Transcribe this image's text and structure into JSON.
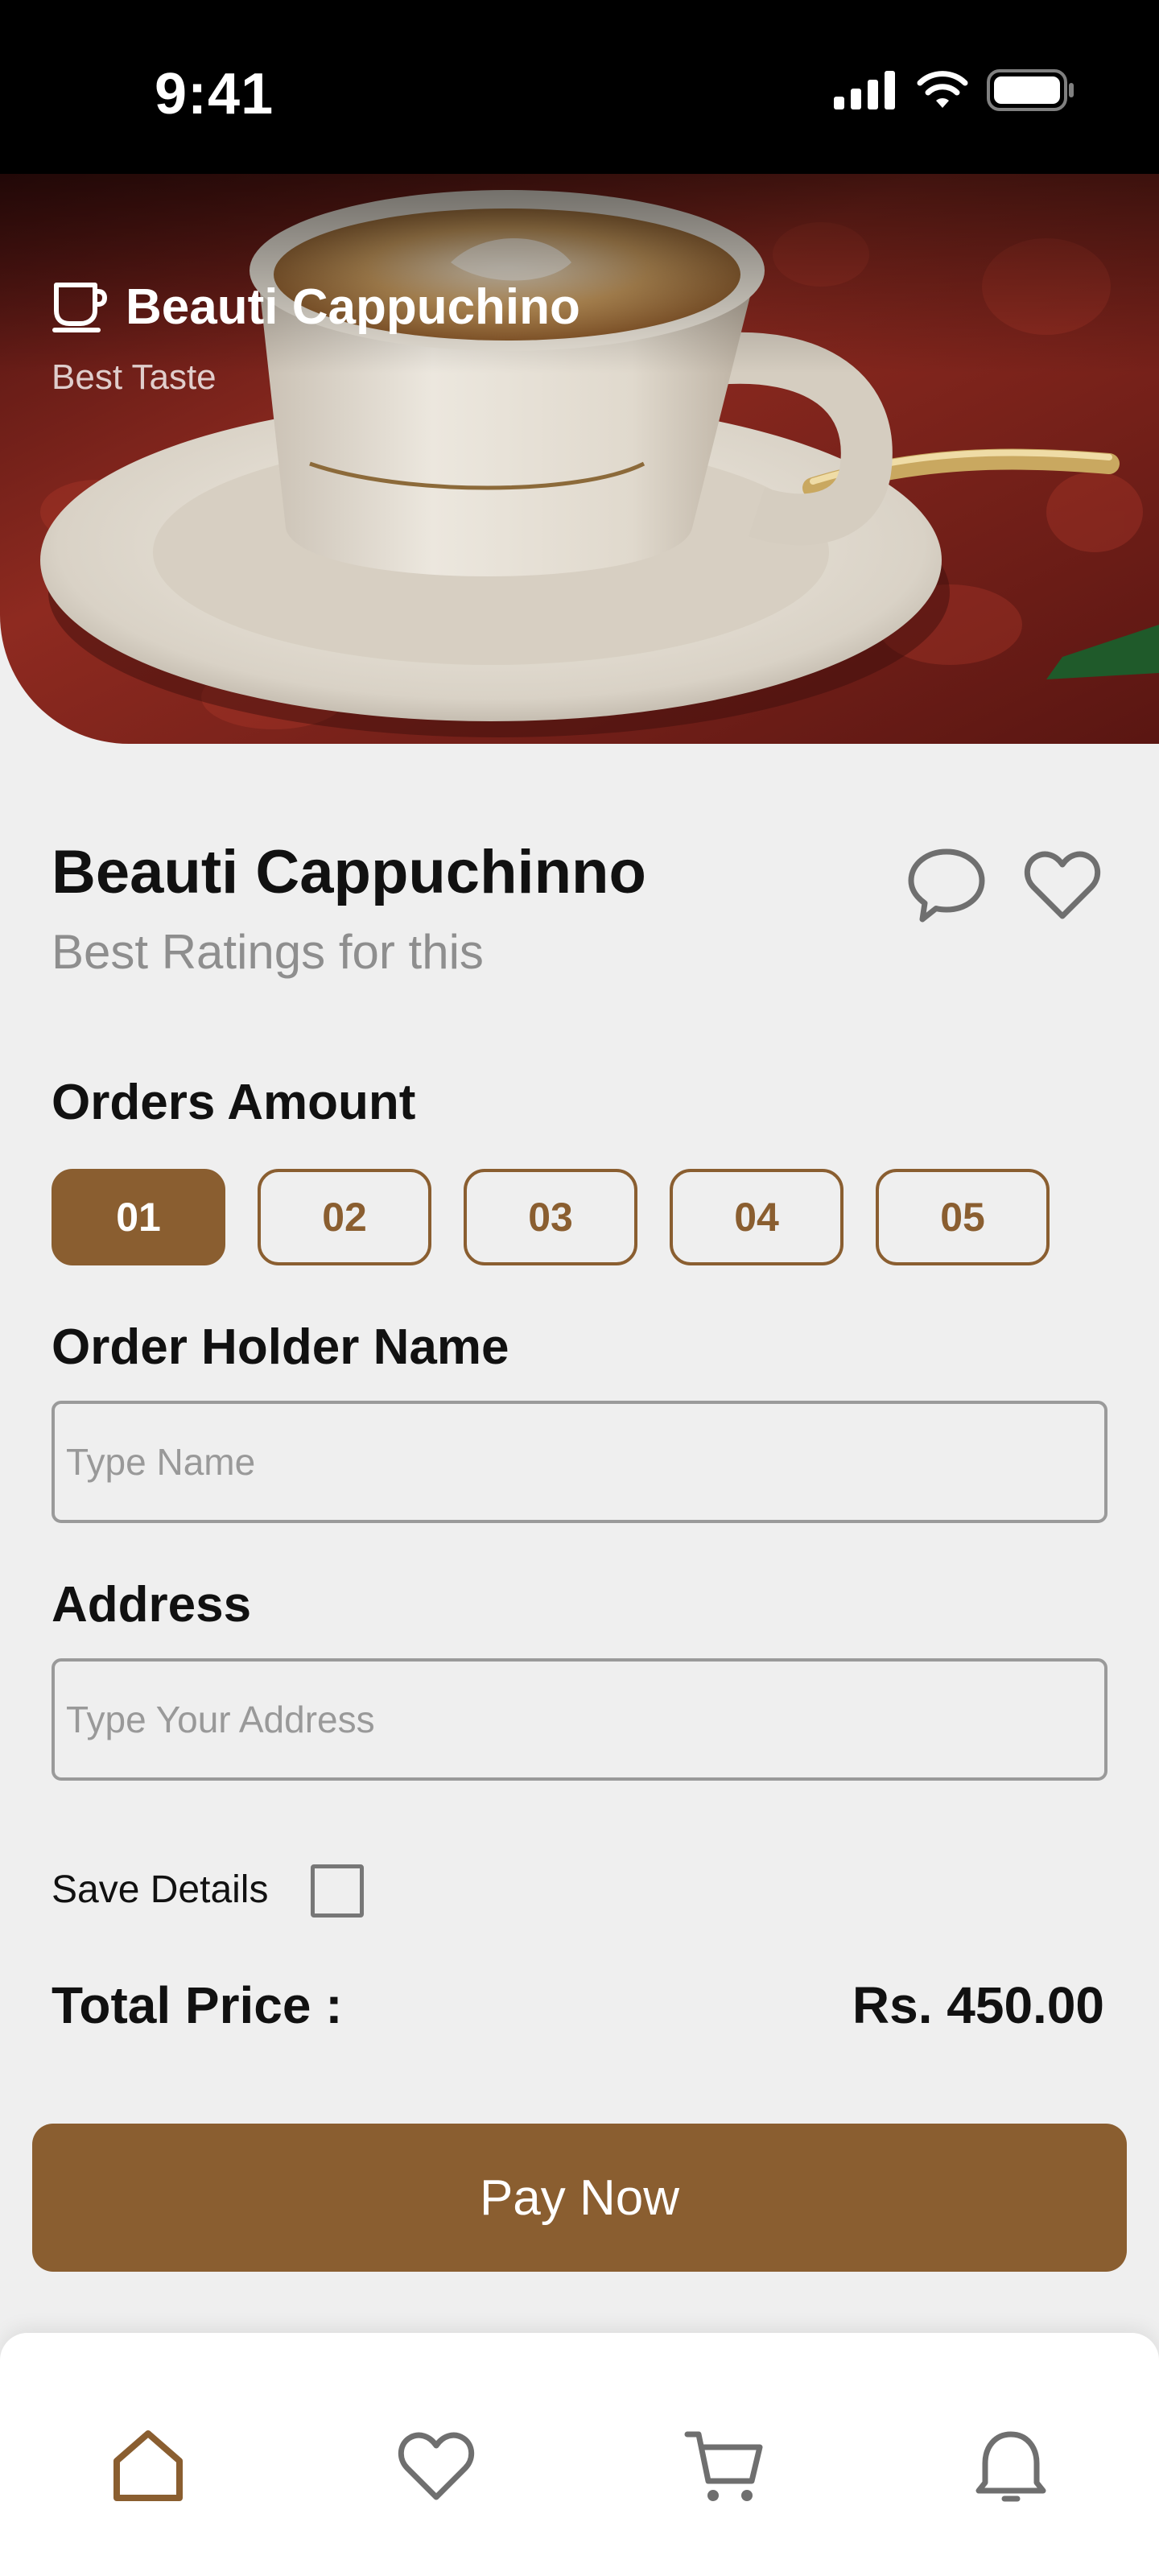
{
  "status_bar": {
    "time": "9:41"
  },
  "hero": {
    "title": "Beauti Cappuchino",
    "subtitle": "Best Taste",
    "icon": "coffee-cup-icon"
  },
  "product": {
    "title": "Beauti Cappuchinno",
    "subtitle": "Best Ratings for this"
  },
  "orders": {
    "label": "Orders Amount",
    "options": [
      "01",
      "02",
      "03",
      "04",
      "05"
    ],
    "selected": "01"
  },
  "form": {
    "name_label": "Order Holder Name",
    "name_placeholder": "Type Name",
    "address_label": "Address",
    "address_placeholder": "Type Your Address",
    "save_label": "Save Details",
    "save_checked": false
  },
  "total": {
    "label": "Total Price :",
    "value": "Rs. 450.00"
  },
  "pay_button": "Pay Now",
  "bottom_nav": {
    "items": [
      "home-icon",
      "heart-icon",
      "cart-icon",
      "bell-icon"
    ],
    "active": "home-icon"
  },
  "colors": {
    "accent": "#8a5e30",
    "background": "#efefef",
    "muted_text": "#8e8e8e"
  }
}
